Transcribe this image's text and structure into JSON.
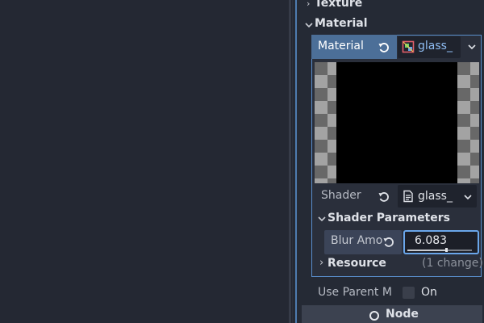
{
  "inspector": {
    "sections": {
      "texture": "Texture",
      "material": "Material"
    },
    "material_tab": "Material",
    "material_picker_value": "glass_",
    "shader_label": "Shader",
    "shader_picker_value": "glass_",
    "shader_parameters_title": "Shader Parameters",
    "blur_amount_label": "Blur Amo",
    "blur_amount_value": "6.083",
    "blur_amount_fraction": 0.6,
    "resource_title": "Resource",
    "resource_changes": "(1 change)",
    "use_parent_label": "Use Parent M",
    "use_parent_toggle_label": "On",
    "node_section": "Node"
  },
  "colors": {
    "accent": "#4c6f98",
    "focus": "#6aa6ea",
    "link": "#8fbdf3"
  },
  "icons": [
    "chevron-right-icon",
    "chevron-down-icon",
    "revert-icon",
    "material-resource-icon",
    "shader-file-icon",
    "node-circle-icon"
  ]
}
